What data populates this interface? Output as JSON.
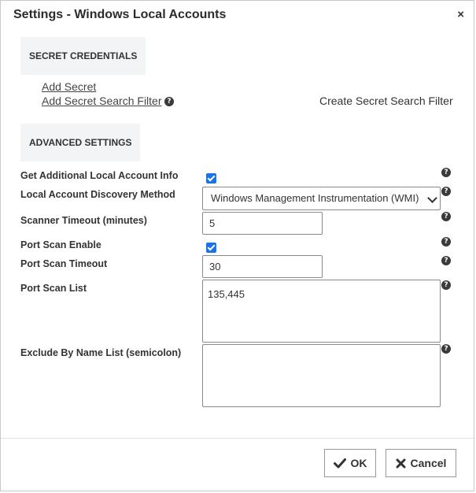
{
  "dialog": {
    "title": "Settings - Windows Local Accounts",
    "close_symbol": "×"
  },
  "secret_credentials": {
    "heading": "SECRET CREDENTIALS",
    "add_secret": "Add Secret",
    "add_filter": "Add Secret Search Filter",
    "create_filter": "Create Secret Search Filter"
  },
  "advanced_settings": {
    "heading": "ADVANCED SETTINGS",
    "get_info_label": "Get Additional Local Account Info",
    "get_info_checked": true,
    "discovery_label": "Local Account Discovery Method",
    "discovery_value": "Windows Management Instrumentation (WMI)",
    "scanner_timeout_label": "Scanner Timeout (minutes)",
    "scanner_timeout_value": "5",
    "port_scan_enable_label": "Port Scan Enable",
    "port_scan_enable_checked": true,
    "port_scan_timeout_label": "Port Scan Timeout",
    "port_scan_timeout_value": "30",
    "port_scan_list_label": "Port Scan List",
    "port_scan_list_value": "135,445",
    "exclude_label": "Exclude By Name List (semicolon)",
    "exclude_value": ""
  },
  "help_symbol": "?",
  "footer": {
    "ok_label": "OK",
    "cancel_label": "Cancel"
  },
  "colors": {
    "checkbox": "#1a73e8",
    "section_bg": "#f3f4f5"
  }
}
